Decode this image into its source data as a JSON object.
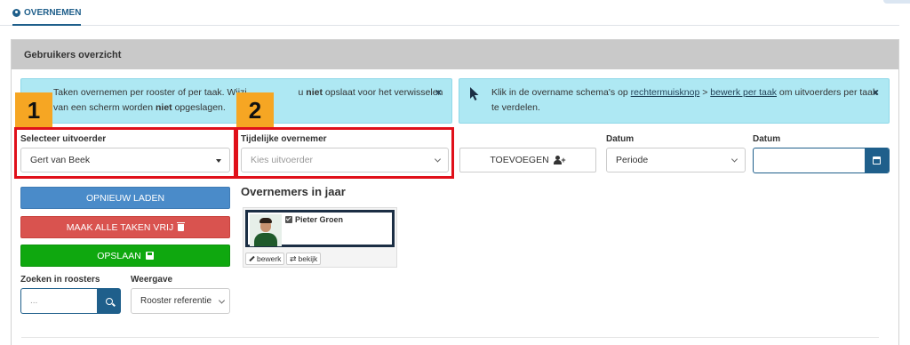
{
  "tabs": {
    "active_label": "OVERNEMEN"
  },
  "panel": {
    "title": "Gebruikers overzicht"
  },
  "alerts": {
    "left": {
      "line1_a": "Taken overnemen per rooster of per taak. Wijzi",
      "line1_b": "u",
      "line1_bold": "niet",
      "line1_c": "opslaat voor het verwisselen",
      "line2_a": "van een scherm worden",
      "line2_bold": "niet",
      "line2_c": "opgeslagen.",
      "close": "×"
    },
    "right": {
      "text_a": "Klik in de overname schema's op",
      "link1": "rechtermuisknop",
      "text_b": ">",
      "link2": "bewerk per taak",
      "text_c": "om uitvoerders per taak",
      "line2": "te verdelen.",
      "close": "×"
    }
  },
  "badges": {
    "one": "1",
    "two": "2"
  },
  "form": {
    "executor_label": "Selecteer uitvoerder",
    "executor_value": "Gert van Beek",
    "temp_label": "Tijdelijke overnemer",
    "temp_placeholder": "Kies uitvoerder",
    "add_button": "TOEVOEGEN",
    "date_label_1": "Datum",
    "date_select_value": "Periode",
    "date_label_2": "Datum",
    "date_input_value": ""
  },
  "actions": {
    "reload": "OPNIEUW LADEN",
    "free_all": "MAAK ALLE TAKEN VRIJ",
    "save": "OPSLAAN"
  },
  "search": {
    "label": "Zoeken in roosters",
    "placeholder": "...",
    "view_label": "Weergave",
    "view_value": "Rooster referentie"
  },
  "takers": {
    "heading": "Overnemers in jaar",
    "card": {
      "name": "Pieter Groen",
      "edit": "bewerk",
      "view": "bekijk"
    }
  },
  "colors": {
    "primary": "#1f5f8b",
    "info_bg": "#aee8f3",
    "badge": "#f6a623",
    "highlight_border": "#e0101a",
    "btn_blue": "#4a8bc9",
    "btn_red": "#d9534f",
    "btn_green": "#0fa80f"
  },
  "icons": [
    "user-circle-icon",
    "close-icon",
    "mouse-pointer-icon",
    "caret-down-icon",
    "user-plus-icon",
    "calendar-icon",
    "trash-icon",
    "save-icon",
    "search-icon",
    "check-square-icon",
    "pencil-icon",
    "retweet-icon"
  ]
}
